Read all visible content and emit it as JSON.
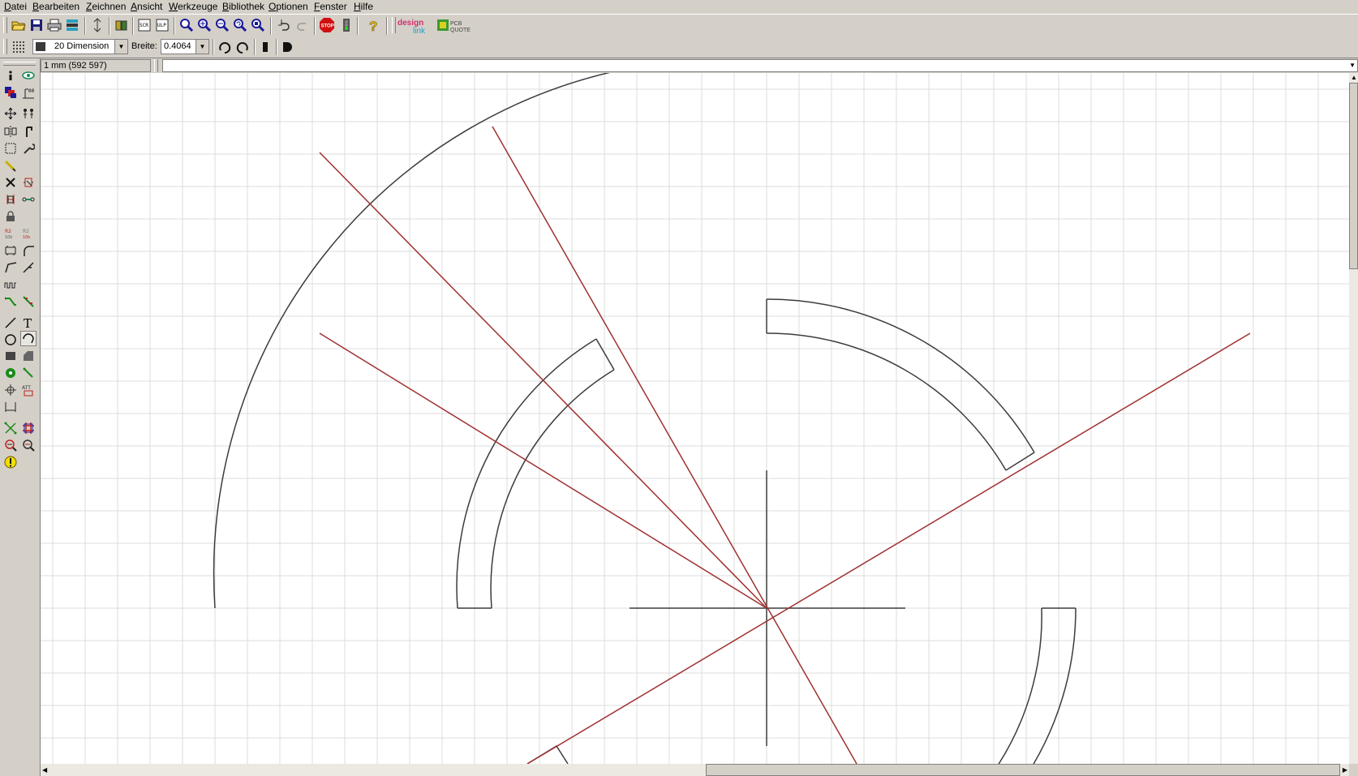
{
  "menu": [
    {
      "label": "Datei",
      "key": "D"
    },
    {
      "label": "Bearbeiten",
      "key": "B"
    },
    {
      "label": "Zeichnen",
      "key": "Z"
    },
    {
      "label": "Ansicht",
      "key": "A"
    },
    {
      "label": "Werkzeuge",
      "key": "W"
    },
    {
      "label": "Bibliothek",
      "key": "B"
    },
    {
      "label": "Optionen",
      "key": "O"
    },
    {
      "label": "Fenster",
      "key": "F"
    },
    {
      "label": "Hilfe",
      "key": "H"
    }
  ],
  "toolbar": {
    "script_label": "SCR",
    "ulp_label": "ULP",
    "stop_label": "STOP",
    "design_link_top": "design",
    "design_link_bottom": "link",
    "pcb_quote_top": "PCB",
    "pcb_quote_bottom": "QUOTE"
  },
  "params": {
    "layer_value": "20 Dimension",
    "layer_color": "#3a3a3a",
    "width_label": "Breite:",
    "width_value": "0.4064"
  },
  "status": {
    "coordinates": "1 mm (592 597)",
    "command": ""
  },
  "colors": {
    "canvas_bg": "#ffffff",
    "grid": "#dcdcdc",
    "dimension_line": "#3c3c3c",
    "construction_line": "#a03030"
  }
}
